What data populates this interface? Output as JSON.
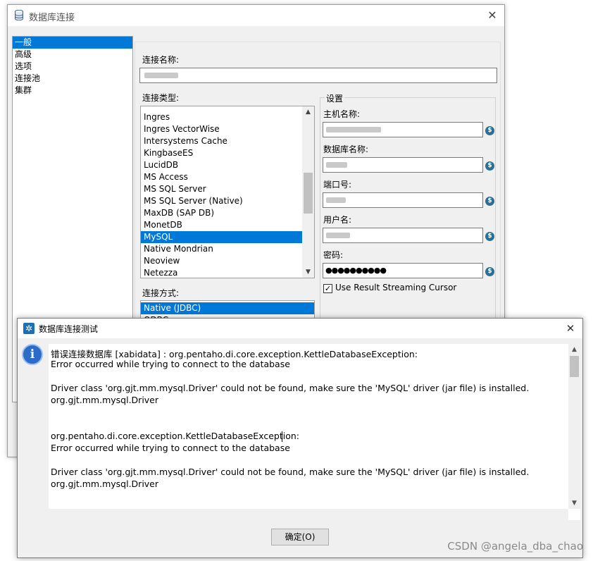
{
  "main_window": {
    "title": "数据库连接",
    "nav": [
      "一般",
      "高级",
      "选项",
      "连接池",
      "集群"
    ],
    "connection_name_label": "连接名称:",
    "connection_type_label": "连接类型:",
    "connection_types": [
      "Ingres",
      "Ingres VectorWise",
      "Intersystems Cache",
      "KingbaseES",
      "LucidDB",
      "MS Access",
      "MS SQL Server",
      "MS SQL Server (Native)",
      "MaxDB (SAP DB)",
      "MonetDB",
      "MySQL",
      "Native Mondrian",
      "Neoview",
      "Netezza"
    ],
    "selected_type": "MySQL",
    "access_label": "连接方式:",
    "access_methods": [
      "Native (JDBC)",
      "ODBC"
    ],
    "settings": {
      "title": "设置",
      "host_label": "主机名称:",
      "db_label": "数据库名称:",
      "port_label": "端口号:",
      "user_label": "用户名:",
      "password_label": "密码:",
      "password_value": "●●●●●●●●●●",
      "streaming_label": "Use Result Streaming Cursor",
      "streaming_checked": true
    }
  },
  "dialog": {
    "title": "数据库连接测试",
    "lines": [
      "错误连接数据库 [xabidata] : org.pentaho.di.core.exception.KettleDatabaseException:",
      "Error occurred while trying to connect to the database",
      "Driver class 'org.gjt.mm.mysql.Driver' could not be found, make sure the 'MySQL' driver (jar file) is installed.",
      "org.gjt.mm.mysql.Driver",
      "org.pentaho.di.core.exception.KettleDatabaseException:",
      "Error occurred while trying to connect to the database",
      "Driver class 'org.gjt.mm.mysql.Driver' could not be found, make sure the 'MySQL' driver (jar file) is installed.",
      "org.gjt.mm.mysql.Driver"
    ],
    "ok_label": "确定(O)"
  },
  "watermark": "CSDN @angela_dba_chao",
  "colors": {
    "selection": "#0078d7",
    "info_icon": "#2c6bc7"
  }
}
